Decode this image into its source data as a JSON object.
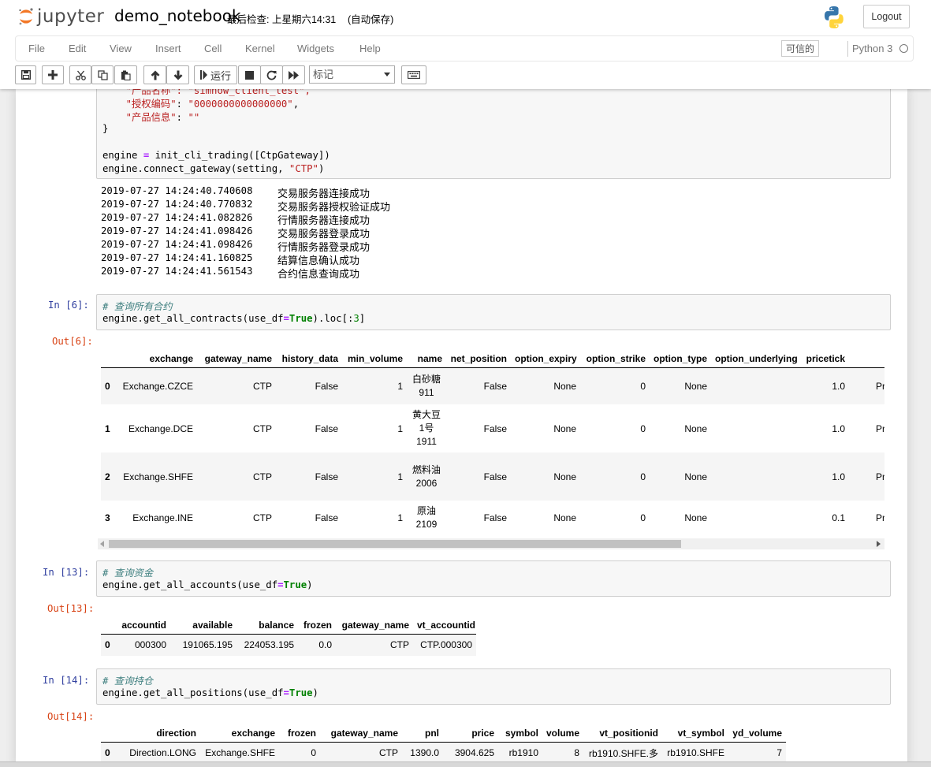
{
  "header": {
    "logo_text": "jupyter",
    "notebook_name": "demo_notebook",
    "checkpoint": "最后检查: 上星期六14:31",
    "autosave": "(自动保存)",
    "logout_label": "Logout"
  },
  "menu": {
    "items": [
      "File",
      "Edit",
      "View",
      "Insert",
      "Cell",
      "Kernel",
      "Widgets",
      "Help"
    ],
    "trusted_label": "可信的",
    "kernel_name": "Python 3"
  },
  "toolbar": {
    "run_label": "运行",
    "cell_type": "标记",
    "buttons": [
      "save-icon",
      "plus-icon",
      "cut-icon",
      "copy-icon",
      "paste-icon",
      "arrow-up-icon",
      "arrow-down-icon",
      "run-icon",
      "stop-icon",
      "restart-icon",
      "fast-forward-icon",
      "keyboard-icon"
    ]
  },
  "cell5": {
    "line1_key": "\"产品名称\"",
    "line1_rest": ": \"simnow_client_test\",",
    "line2_key": "\"授权编码\"",
    "line2_val": "\"0000000000000000\"",
    "line3_key": "\"产品信息\"",
    "line3_val": "\"\"",
    "brace": "}",
    "engine_var": "engine",
    "init_call": "init_cli_trading([CtpGateway])",
    "connect_call": "engine.connect_gateway(setting, ",
    "connect_arg": "\"CTP\"",
    "connect_close": ")"
  },
  "log": [
    {
      "ts": "2019-07-27 14:24:40.740608",
      "msg": "交易服务器连接成功"
    },
    {
      "ts": "2019-07-27 14:24:40.770832",
      "msg": "交易服务器授权验证成功"
    },
    {
      "ts": "2019-07-27 14:24:41.082826",
      "msg": "行情服务器连接成功"
    },
    {
      "ts": "2019-07-27 14:24:41.098426",
      "msg": "交易服务器登录成功"
    },
    {
      "ts": "2019-07-27 14:24:41.098426",
      "msg": "行情服务器登录成功"
    },
    {
      "ts": "2019-07-27 14:24:41.160825",
      "msg": "结算信息确认成功"
    },
    {
      "ts": "2019-07-27 14:24:41.561543",
      "msg": "合约信息查询成功"
    }
  ],
  "cell6": {
    "prompt_in": "In  [6]:",
    "prompt_out": "Out[6]:",
    "comment": "# 查询所有合约",
    "code_a": "engine.get_all_contracts(use_df",
    "code_b": "True",
    "code_c": ").loc[:",
    "code_d": "3",
    "code_e": "]",
    "columns": [
      "",
      "exchange",
      "gateway_name",
      "history_data",
      "min_volume",
      "name",
      "net_position",
      "option_expiry",
      "option_strike",
      "option_type",
      "option_underlying",
      "pricetick",
      ""
    ],
    "rows": [
      [
        "0",
        "Exchange.CZCE",
        "CTP",
        "False",
        "1",
        "白砂糖911",
        "False",
        "None",
        "0",
        "None",
        "",
        "1.0",
        "Product.F"
      ],
      [
        "1",
        "Exchange.DCE",
        "CTP",
        "False",
        "1",
        "黄大豆1号1911",
        "False",
        "None",
        "0",
        "None",
        "",
        "1.0",
        "Product.F"
      ],
      [
        "2",
        "Exchange.SHFE",
        "CTP",
        "False",
        "1",
        "燃料油2006",
        "False",
        "None",
        "0",
        "None",
        "",
        "1.0",
        "Product.F"
      ],
      [
        "3",
        "Exchange.INE",
        "CTP",
        "False",
        "1",
        "原油2109",
        "False",
        "None",
        "0",
        "None",
        "",
        "0.1",
        "Product.F"
      ]
    ]
  },
  "cell13": {
    "prompt_in": "In  [13]:",
    "prompt_out": "Out[13]:",
    "comment": "# 查询资金",
    "code_a": "engine.get_all_accounts(use_df",
    "code_b": "True",
    "code_c": ")",
    "columns": [
      "",
      "accountid",
      "available",
      "balance",
      "frozen",
      "gateway_name",
      "vt_accountid"
    ],
    "rows": [
      [
        "0",
        "000300",
        "191065.195",
        "224053.195",
        "0.0",
        "CTP",
        "CTP.000300"
      ]
    ]
  },
  "cell14": {
    "prompt_in": "In  [14]:",
    "prompt_out": "Out[14]:",
    "comment": "# 查询持仓",
    "code_a": "engine.get_all_positions(use_df",
    "code_b": "True",
    "code_c": ")",
    "columns": [
      "",
      "direction",
      "exchange",
      "frozen",
      "gateway_name",
      "pnl",
      "price",
      "symbol",
      "volume",
      "vt_positionid",
      "vt_symbol",
      "yd_volume"
    ],
    "rows": [
      [
        "0",
        "Direction.LONG",
        "Exchange.SHFE",
        "0",
        "CTP",
        "1390.0",
        "3904.625",
        "rb1910",
        "8",
        "rb1910.SHFE.多",
        "rb1910.SHFE",
        "7"
      ]
    ]
  },
  "colors": {
    "prompt_in": "#303f9f",
    "prompt_out": "#d84315",
    "string": "#ba2121",
    "comment": "#408080",
    "keyword": "#008000"
  }
}
